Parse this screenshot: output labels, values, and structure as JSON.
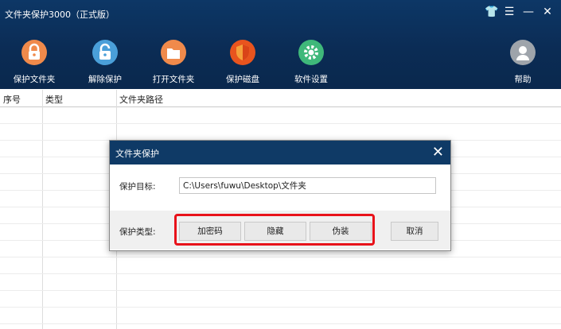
{
  "app": {
    "title": "文件夹保护3000（正式版）"
  },
  "window_controls": {
    "shirt": "👕",
    "menu": "☰",
    "minimize": "—",
    "close": "✕"
  },
  "toolbar": {
    "items": [
      {
        "label": "保护文件夹",
        "icon": "lock-icon",
        "color": "#f08a4b"
      },
      {
        "label": "解除保护",
        "icon": "unlock-icon",
        "color": "#4a9fd9"
      },
      {
        "label": "打开文件夹",
        "icon": "folder-icon",
        "color": "#f08a4b"
      },
      {
        "label": "保护磁盘",
        "icon": "shield-icon",
        "color": "#e8541e"
      },
      {
        "label": "软件设置",
        "icon": "gear-icon",
        "color": "#3fb87a"
      },
      {
        "label": "帮助",
        "icon": "user-icon",
        "color": "#9ea4ab"
      }
    ]
  },
  "table": {
    "columns": [
      "序号",
      "类型",
      "文件夹路径"
    ]
  },
  "dialog": {
    "title": "文件夹保护",
    "close": "✕",
    "target_label": "保护目标:",
    "target_value": "C:\\Users\\fuwu\\Desktop\\文件夹",
    "type_label": "保护类型:",
    "buttons": {
      "encrypt": "加密码",
      "hide": "隐藏",
      "disguise": "伪装",
      "cancel": "取消"
    }
  },
  "colors": {
    "header_bg": "#0b2c55",
    "highlight": "#e8121a"
  }
}
